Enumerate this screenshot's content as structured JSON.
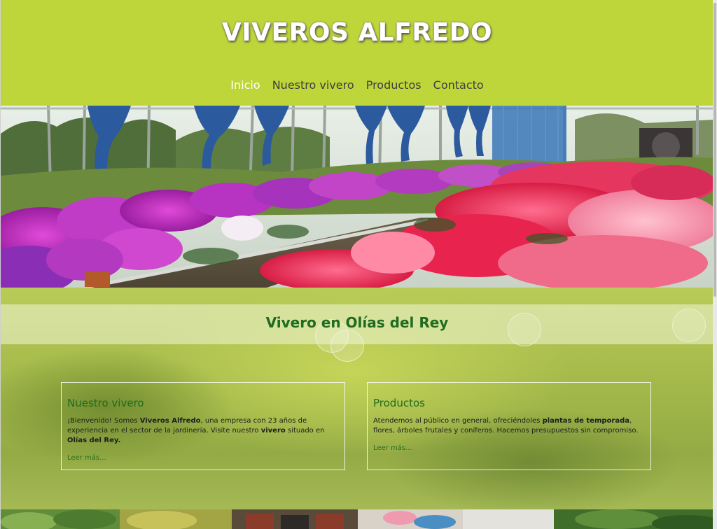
{
  "header": {
    "logo": "VIVEROS ALFREDO",
    "nav": [
      {
        "label": "Inicio",
        "active": true
      },
      {
        "label": "Nuestro vivero",
        "active": false
      },
      {
        "label": "Productos",
        "active": false
      },
      {
        "label": "Contacto",
        "active": false
      }
    ]
  },
  "main": {
    "title": "Vivero en Olías del Rey",
    "cards": [
      {
        "title": "Nuestro vivero",
        "text": [
          {
            "t": "¡Bienvenido! Somos ",
            "b": false
          },
          {
            "t": "Viveros Alfredo",
            "b": true
          },
          {
            "t": ", una empresa con 23 años de experiencia en el sector de la jardinería. Visite nuestro ",
            "b": false
          },
          {
            "t": "vivero",
            "b": true
          },
          {
            "t": " situado en ",
            "b": false
          },
          {
            "t": "Olías del Rey.",
            "b": true
          }
        ],
        "link": "Leer más..."
      },
      {
        "title": "Productos",
        "text": [
          {
            "t": "Atendemos al público en general, ofreciéndoles ",
            "b": false
          },
          {
            "t": "plantas de temporada",
            "b": true
          },
          {
            "t": ", flores, árboles frutales y coníferos. Hacemos presupuestos sin compromiso.",
            "b": false
          }
        ],
        "link": "Leer más..."
      }
    ]
  },
  "colors": {
    "header_bg": "#bfd63a",
    "accent_green": "#1f6b1f",
    "nav_active": "#ffffff",
    "nav_text": "#3e3e3e"
  }
}
